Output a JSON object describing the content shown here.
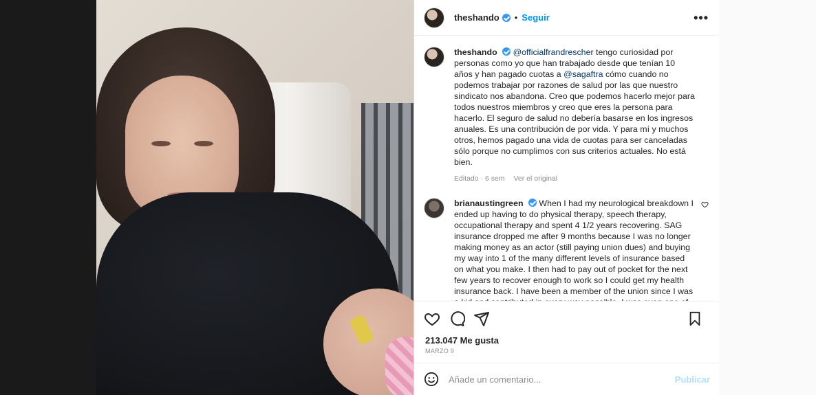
{
  "post": {
    "username": "theshando",
    "follow_label": "Seguir",
    "separator": "•",
    "more_label": "•••"
  },
  "caption": {
    "username": "theshando",
    "mention1": "@officialfrandrescher",
    "text1": " tengo curiosidad por personas como yo que han trabajado desde que tenían 10 años y han pagado cuotas a ",
    "mention2": "@sagaftra",
    "text2": " cómo cuando no podemos trabajar por razones de salud por las que nuestro sindicato nos abandona. Creo que podemos hacerlo mejor para todos nuestros miembros y creo que eres la persona para hacerlo. El seguro de salud no debería basarse en los ingresos anuales. Es una contribución de por vida. Y para mí y muchos otros, hemos pagado una vida de cuotas para ser canceladas sólo porque no cumplimos con sus criterios actuales. No está bien.",
    "edited": "Editado · 6 sem",
    "see_original": "Ver el original"
  },
  "comment": {
    "username": "brianaustingreen",
    "text": " When I had my neurological breakdown I ended up having to do physical therapy, speech therapy, occupational therapy and spent 4 1/2 years recovering. SAG insurance dropped me after 9 months because I was no longer making money as an actor (still paying union dues) and buying my way into 1 of the many different levels of insurance based on what you make. I then had to pay out of pocket for the next few years to recover enough to work so I could get my health insurance back. I have been a member of the union since I was a kid and contributed in every way possible. I was even one of the many actors who contributed to the pension plan."
  },
  "stats": {
    "likes": "213.047 Me gusta",
    "date": "MARZO 9"
  },
  "add_comment": {
    "placeholder": "Añade un comentario...",
    "publish_label": "Publicar"
  },
  "icons": {
    "like": "heart-icon",
    "comment": "comment-icon",
    "share": "share-icon",
    "save": "bookmark-icon",
    "emoji": "emoji-icon",
    "verified": "verified-badge-icon"
  },
  "colors": {
    "link": "#0095f6",
    "mention": "#00376b",
    "verified": "#3897f0",
    "muted": "#8e8e8e",
    "text": "#262626",
    "publish_disabled": "#b2dffc"
  }
}
